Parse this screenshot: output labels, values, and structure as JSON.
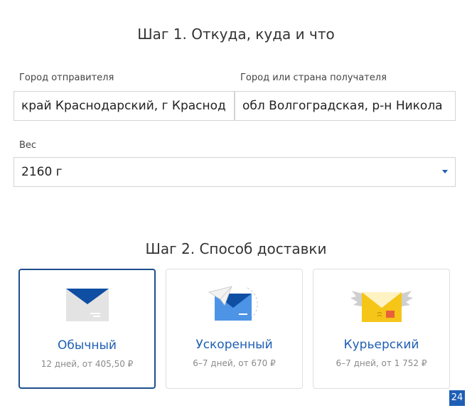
{
  "step1": {
    "title": "Шаг 1. Откуда, куда и что",
    "sender_label": "Город отправителя",
    "sender_value": "край Краснодарский, г Краснод",
    "recipient_label": "Город или страна получателя",
    "recipient_value": "обл Волгоградская, р-н Никола",
    "weight_label": "Вес",
    "weight_value": "2160 г"
  },
  "step2": {
    "title": "Шаг 2. Способ доставки",
    "options": [
      {
        "name": "Обычный",
        "meta": "12 дней, от 405,50 ₽",
        "selected": true,
        "icon": "envelope-icon"
      },
      {
        "name": "Ускоренный",
        "meta": "6–7 дней, от 670 ₽",
        "selected": false,
        "icon": "paper-plane-envelope-icon"
      },
      {
        "name": "Курьерский",
        "meta": "6–7 дней, от 1 752 ₽",
        "selected": false,
        "icon": "winged-envelope-icon"
      }
    ]
  },
  "badge": {
    "text": "24"
  },
  "colors": {
    "accent": "#1e5fb4",
    "selected_border": "#1e4f8c",
    "courier_yellow": "#f5c518"
  }
}
